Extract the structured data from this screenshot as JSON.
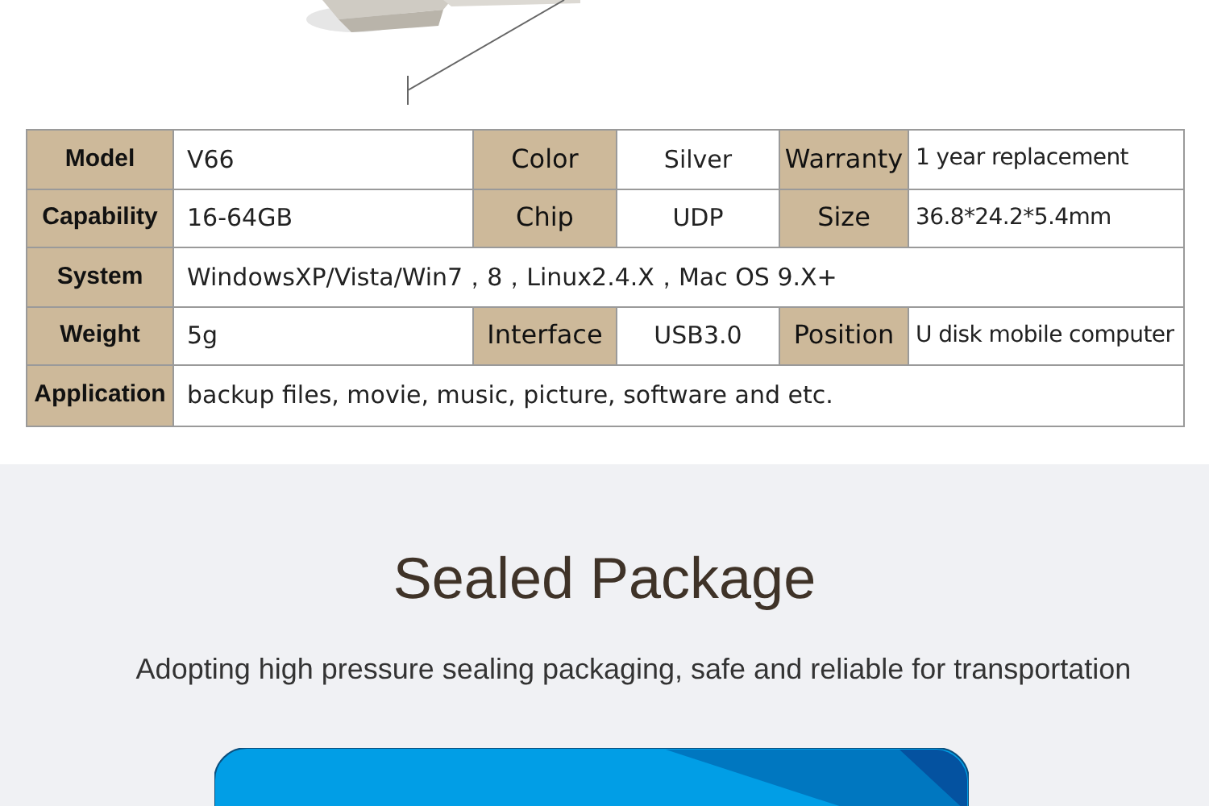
{
  "spec_table": {
    "rows": [
      {
        "kind": "pairs",
        "pairs": [
          {
            "label": "Model",
            "bold": true,
            "value": "V66"
          },
          {
            "label": "Color",
            "bold": false,
            "value": "Silver"
          },
          {
            "label": "Warranty",
            "bold": false,
            "value": "1 year replacement"
          }
        ]
      },
      {
        "kind": "pairs",
        "pairs": [
          {
            "label": "Capability",
            "bold": true,
            "value": "16-64GB"
          },
          {
            "label": "Chip",
            "bold": false,
            "value": "UDP"
          },
          {
            "label": "Size",
            "bold": false,
            "value": "36.8*24.2*5.4mm"
          }
        ]
      },
      {
        "kind": "wide",
        "pairs": [
          {
            "label": "System",
            "bold": true,
            "value": "WindowsXP/Vista/Win7，8，Linux2.4.X，Mac OS 9.X+"
          }
        ]
      },
      {
        "kind": "pairs",
        "pairs": [
          {
            "label": "Weight",
            "bold": true,
            "value": "5g"
          },
          {
            "label": "Interface",
            "bold": false,
            "value": "USB3.0"
          },
          {
            "label": "Position",
            "bold": false,
            "value": "U disk mobile computer"
          }
        ]
      },
      {
        "kind": "wide",
        "pairs": [
          {
            "label": "Application",
            "bold": true,
            "value": "backup files, movie, music, picture, software and etc."
          }
        ]
      }
    ]
  },
  "section": {
    "title": "Sealed Package",
    "subtitle": "Adopting high pressure sealing packaging, safe and reliable for transportation"
  }
}
